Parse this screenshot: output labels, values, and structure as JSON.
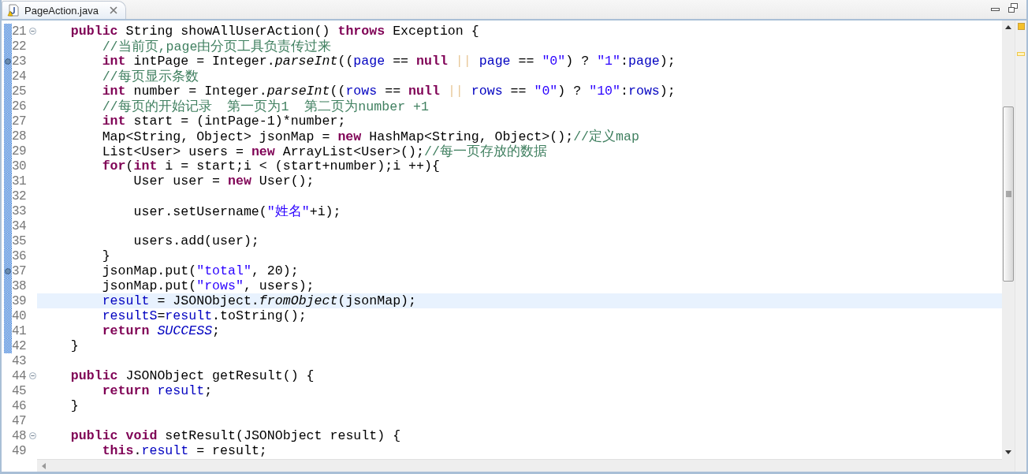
{
  "tab": {
    "title": "PageAction.java",
    "selected": true
  },
  "lines": [
    {
      "number": "21",
      "fold": true,
      "annotation": false,
      "range": true,
      "current": false,
      "tokens": [
        {
          "kind": "keyword",
          "text": "    public"
        },
        {
          "kind": "plain",
          "text": " String showAllUserAction() "
        },
        {
          "kind": "keyword",
          "text": "throws"
        },
        {
          "kind": "plain",
          "text": " Exception {"
        }
      ]
    },
    {
      "number": "22",
      "fold": false,
      "annotation": false,
      "range": true,
      "current": false,
      "tokens": [
        {
          "kind": "comment",
          "text": "        //当前页,page由分页工具负责传过来"
        }
      ]
    },
    {
      "number": "23",
      "fold": false,
      "annotation": true,
      "range": true,
      "current": false,
      "tokens": [
        {
          "kind": "keyword",
          "text": "        int"
        },
        {
          "kind": "plain",
          "text": " intPage = Integer."
        },
        {
          "kind": "method",
          "text": "parseInt"
        },
        {
          "kind": "plain",
          "text": "(("
        },
        {
          "kind": "field",
          "text": "page"
        },
        {
          "kind": "plain",
          "text": " == "
        },
        {
          "kind": "keyword",
          "text": "null"
        },
        {
          "kind": "faint",
          "text": " || "
        },
        {
          "kind": "field",
          "text": "page"
        },
        {
          "kind": "plain",
          "text": " == "
        },
        {
          "kind": "string",
          "text": "\"0\""
        },
        {
          "kind": "plain",
          "text": ") ? "
        },
        {
          "kind": "string",
          "text": "\"1\""
        },
        {
          "kind": "plain",
          "text": ":"
        },
        {
          "kind": "field",
          "text": "page"
        },
        {
          "kind": "plain",
          "text": ");"
        }
      ]
    },
    {
      "number": "24",
      "fold": false,
      "annotation": false,
      "range": true,
      "current": false,
      "tokens": [
        {
          "kind": "comment",
          "text": "        //每页显示条数"
        }
      ]
    },
    {
      "number": "25",
      "fold": false,
      "annotation": false,
      "range": true,
      "current": false,
      "tokens": [
        {
          "kind": "keyword",
          "text": "        int"
        },
        {
          "kind": "plain",
          "text": " number = Integer."
        },
        {
          "kind": "method",
          "text": "parseInt"
        },
        {
          "kind": "plain",
          "text": "(("
        },
        {
          "kind": "field",
          "text": "rows"
        },
        {
          "kind": "plain",
          "text": " == "
        },
        {
          "kind": "keyword",
          "text": "null"
        },
        {
          "kind": "faint",
          "text": " || "
        },
        {
          "kind": "field",
          "text": "rows"
        },
        {
          "kind": "plain",
          "text": " == "
        },
        {
          "kind": "string",
          "text": "\"0\""
        },
        {
          "kind": "plain",
          "text": ") ? "
        },
        {
          "kind": "string",
          "text": "\"10\""
        },
        {
          "kind": "plain",
          "text": ":"
        },
        {
          "kind": "field",
          "text": "rows"
        },
        {
          "kind": "plain",
          "text": ");"
        }
      ]
    },
    {
      "number": "26",
      "fold": false,
      "annotation": false,
      "range": true,
      "current": false,
      "tokens": [
        {
          "kind": "comment",
          "text": "        //每页的开始记录  第一页为1  第二页为number +1"
        }
      ]
    },
    {
      "number": "27",
      "fold": false,
      "annotation": false,
      "range": true,
      "current": false,
      "tokens": [
        {
          "kind": "keyword",
          "text": "        int"
        },
        {
          "kind": "plain",
          "text": " start = (intPage-1)*number;"
        }
      ]
    },
    {
      "number": "28",
      "fold": false,
      "annotation": false,
      "range": true,
      "current": false,
      "tokens": [
        {
          "kind": "plain",
          "text": "        Map<String, Object> jsonMap = "
        },
        {
          "kind": "keyword",
          "text": "new"
        },
        {
          "kind": "plain",
          "text": " HashMap<String, Object>();"
        },
        {
          "kind": "comment",
          "text": "//定义map"
        }
      ]
    },
    {
      "number": "29",
      "fold": false,
      "annotation": false,
      "range": true,
      "current": false,
      "tokens": [
        {
          "kind": "plain",
          "text": "        List<User> users = "
        },
        {
          "kind": "keyword",
          "text": "new"
        },
        {
          "kind": "plain",
          "text": " ArrayList<User>();"
        },
        {
          "kind": "comment",
          "text": "//每一页存放的数据"
        }
      ]
    },
    {
      "number": "30",
      "fold": false,
      "annotation": false,
      "range": true,
      "current": false,
      "tokens": [
        {
          "kind": "keyword",
          "text": "        for"
        },
        {
          "kind": "plain",
          "text": "("
        },
        {
          "kind": "keyword",
          "text": "int"
        },
        {
          "kind": "plain",
          "text": " i = start;i < (start+number);i ++){"
        }
      ]
    },
    {
      "number": "31",
      "fold": false,
      "annotation": false,
      "range": true,
      "current": false,
      "tokens": [
        {
          "kind": "plain",
          "text": "            User user = "
        },
        {
          "kind": "keyword",
          "text": "new"
        },
        {
          "kind": "plain",
          "text": " User();"
        }
      ]
    },
    {
      "number": "32",
      "fold": false,
      "annotation": false,
      "range": true,
      "current": false
    },
    {
      "number": "33",
      "fold": false,
      "annotation": false,
      "range": true,
      "current": false,
      "tokens": [
        {
          "kind": "plain",
          "text": "            user.setUsername("
        },
        {
          "kind": "string",
          "text": "\"姓名\""
        },
        {
          "kind": "plain",
          "text": "+i);"
        }
      ]
    },
    {
      "number": "34",
      "fold": false,
      "annotation": false,
      "range": true,
      "current": false
    },
    {
      "number": "35",
      "fold": false,
      "annotation": false,
      "range": true,
      "current": false,
      "tokens": [
        {
          "kind": "plain",
          "text": "            users.add(user);"
        }
      ]
    },
    {
      "number": "36",
      "fold": false,
      "annotation": false,
      "range": true,
      "current": false,
      "tokens": [
        {
          "kind": "plain",
          "text": "        }"
        }
      ]
    },
    {
      "number": "37",
      "fold": false,
      "annotation": true,
      "range": true,
      "current": false,
      "tokens": [
        {
          "kind": "plain",
          "text": "        jsonMap.put("
        },
        {
          "kind": "string",
          "text": "\"total\""
        },
        {
          "kind": "plain",
          "text": ", 20);"
        }
      ]
    },
    {
      "number": "38",
      "fold": false,
      "annotation": false,
      "range": true,
      "current": false,
      "tokens": [
        {
          "kind": "plain",
          "text": "        jsonMap.put("
        },
        {
          "kind": "string",
          "text": "\"rows\""
        },
        {
          "kind": "plain",
          "text": ", users);"
        }
      ]
    },
    {
      "number": "39",
      "fold": false,
      "annotation": false,
      "range": true,
      "current": true,
      "tokens": [
        {
          "kind": "field",
          "text": "        result"
        },
        {
          "kind": "plain",
          "text": " = JSONObject."
        },
        {
          "kind": "method",
          "text": "fromObject"
        },
        {
          "kind": "plain",
          "text": "(jsonMap);"
        }
      ]
    },
    {
      "number": "40",
      "fold": false,
      "annotation": false,
      "range": true,
      "current": false,
      "tokens": [
        {
          "kind": "field",
          "text": "        resultS"
        },
        {
          "kind": "plain",
          "text": "="
        },
        {
          "kind": "field",
          "text": "result"
        },
        {
          "kind": "plain",
          "text": ".toString();"
        }
      ]
    },
    {
      "number": "41",
      "fold": false,
      "annotation": false,
      "range": true,
      "current": false,
      "tokens": [
        {
          "kind": "keyword",
          "text": "        return"
        },
        {
          "kind": "constant",
          "text": " SUCCESS"
        },
        {
          "kind": "plain",
          "text": ";"
        }
      ]
    },
    {
      "number": "42",
      "fold": false,
      "annotation": false,
      "range": true,
      "current": false,
      "tokens": [
        {
          "kind": "plain",
          "text": "    }"
        }
      ]
    },
    {
      "number": "43",
      "fold": false,
      "annotation": false,
      "range": false,
      "current": false
    },
    {
      "number": "44",
      "fold": true,
      "annotation": false,
      "range": false,
      "current": false,
      "tokens": [
        {
          "kind": "keyword",
          "text": "    public"
        },
        {
          "kind": "plain",
          "text": " JSONObject getResult() {"
        }
      ]
    },
    {
      "number": "45",
      "fold": false,
      "annotation": false,
      "range": false,
      "current": false,
      "tokens": [
        {
          "kind": "keyword",
          "text": "        return"
        },
        {
          "kind": "field",
          "text": " result"
        },
        {
          "kind": "plain",
          "text": ";"
        }
      ]
    },
    {
      "number": "46",
      "fold": false,
      "annotation": false,
      "range": false,
      "current": false,
      "tokens": [
        {
          "kind": "plain",
          "text": "    }"
        }
      ]
    },
    {
      "number": "47",
      "fold": false,
      "annotation": false,
      "range": false,
      "current": false
    },
    {
      "number": "48",
      "fold": true,
      "annotation": false,
      "range": false,
      "current": false,
      "tokens": [
        {
          "kind": "keyword",
          "text": "    public"
        },
        {
          "kind": "keyword",
          "text": " void"
        },
        {
          "kind": "plain",
          "text": " setResult(JSONObject result) {"
        }
      ]
    },
    {
      "number": "49",
      "fold": false,
      "annotation": false,
      "range": false,
      "current": false,
      "tokens": [
        {
          "kind": "keyword",
          "text": "        this"
        },
        {
          "kind": "plain",
          "text": "."
        },
        {
          "kind": "field",
          "text": "result"
        },
        {
          "kind": "plain",
          "text": " = result;"
        }
      ]
    }
  ]
}
